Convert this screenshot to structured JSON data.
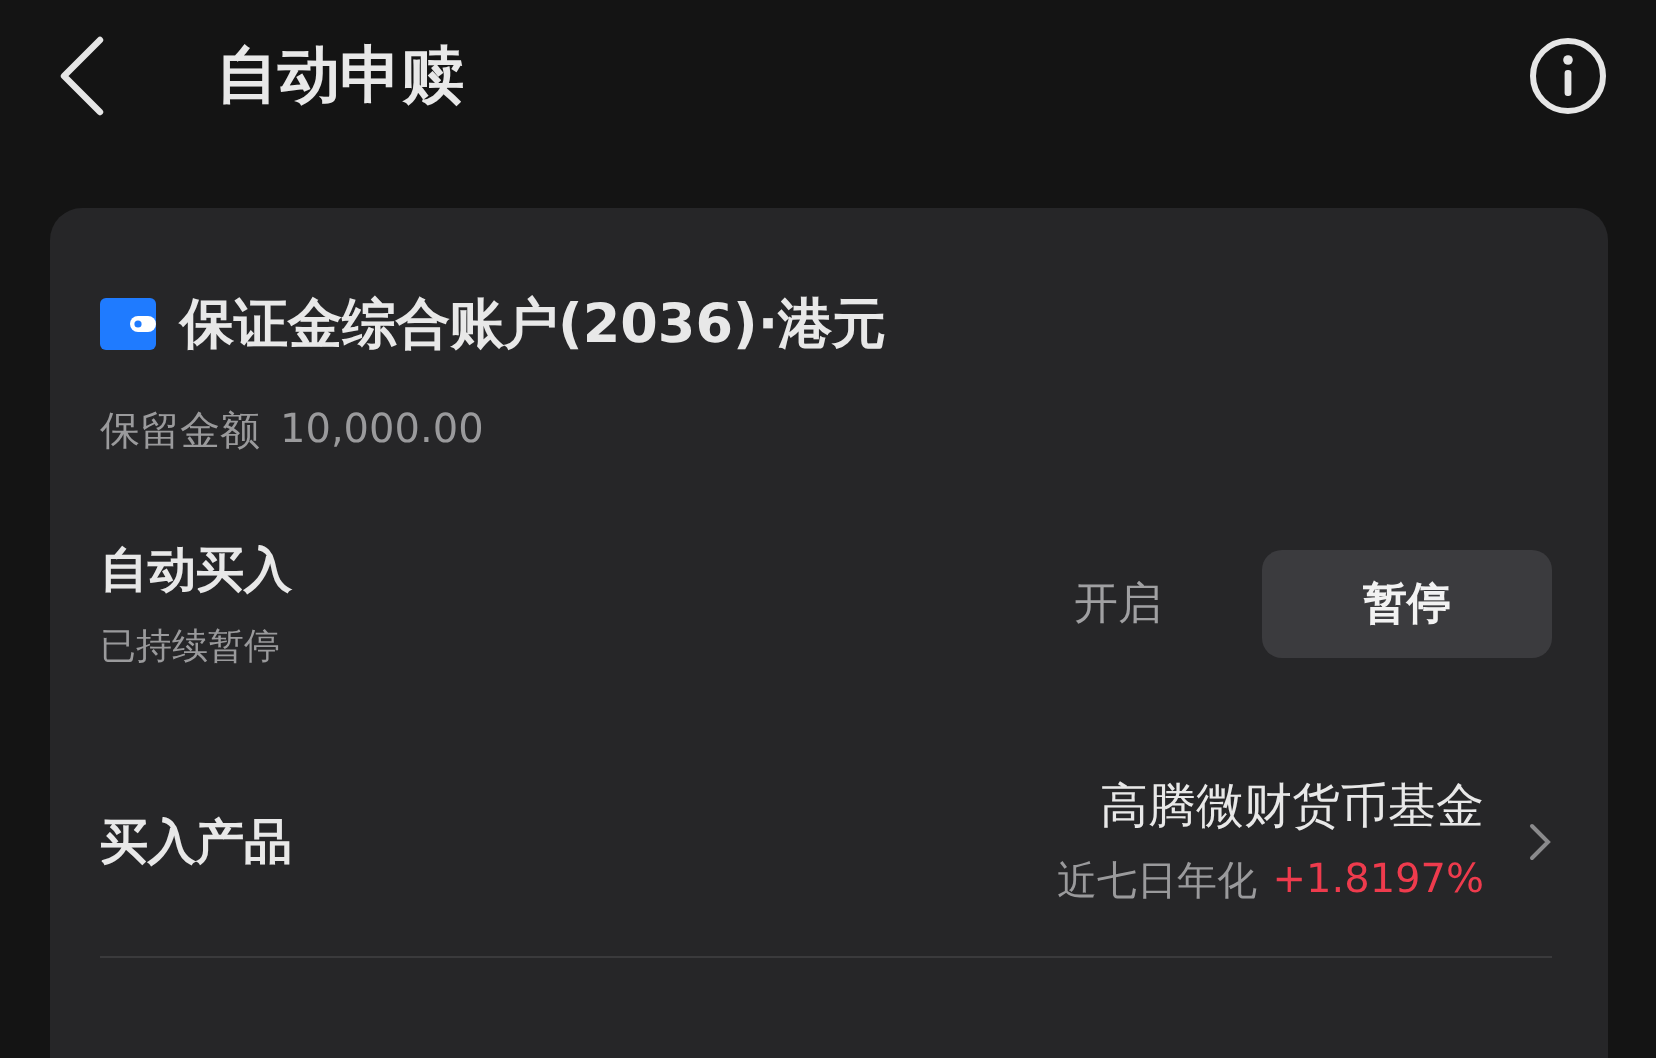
{
  "header": {
    "title": "自动申赎"
  },
  "account": {
    "name": "保证金综合账户(2036)·港元",
    "reserve_label": "保留金额",
    "reserve_value": "10,000.00"
  },
  "auto_buy": {
    "label": "自动买入",
    "status": "已持续暂停",
    "options": [
      {
        "label": "开启",
        "selected": false
      },
      {
        "label": "暂停",
        "selected": true
      }
    ]
  },
  "product": {
    "label": "买入产品",
    "name": "高腾微财货币基金",
    "yield_label": "近七日年化",
    "yield_value": "+1.8197%"
  }
}
